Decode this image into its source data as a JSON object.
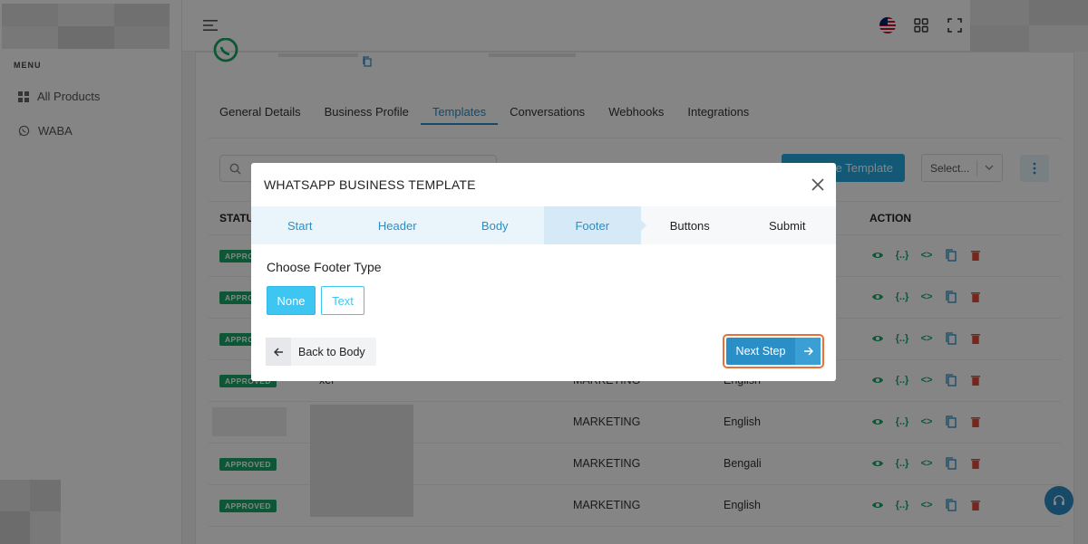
{
  "sidebar": {
    "menu_title": "MENU",
    "items": [
      {
        "label": "All Products",
        "icon": "grid-icon"
      },
      {
        "label": "WABA",
        "icon": "whatsapp-icon"
      }
    ]
  },
  "tabs": [
    "General Details",
    "Business Profile",
    "Templates",
    "Conversations",
    "Webhooks",
    "Integrations"
  ],
  "active_tab": "Templates",
  "toolbar": {
    "create_label": "e Template",
    "select_value": "Select..."
  },
  "table": {
    "headers": {
      "status": "STATU",
      "action": "ACTION"
    },
    "rows": [
      {
        "status": "APPROVED",
        "name": "",
        "category": "",
        "language": ""
      },
      {
        "status": "APPROVED",
        "name": "",
        "category": "",
        "language": ""
      },
      {
        "status": "APPROVED",
        "name": "",
        "category": "",
        "language": ""
      },
      {
        "status": "APPROVED",
        "name": "xel",
        "category": "MARKETING",
        "language": "English"
      },
      {
        "status": "",
        "name": "",
        "category": "MARKETING",
        "language": "English"
      },
      {
        "status": "APPROVED",
        "name": "",
        "category": "MARKETING",
        "language": "Bengali"
      },
      {
        "status": "APPROVED",
        "name": "",
        "category": "MARKETING",
        "language": "English"
      }
    ]
  },
  "modal": {
    "title": "WHATSAPP BUSINESS TEMPLATE",
    "steps": [
      "Start",
      "Header",
      "Body",
      "Footer",
      "Buttons",
      "Submit"
    ],
    "current_step": "Footer",
    "section_title": "Choose Footer Type",
    "options": [
      "None",
      "Text"
    ],
    "selected_option": "None",
    "back_label": "Back to Body",
    "next_label": "Next Step"
  },
  "colors": {
    "primary": "#2b8fc7",
    "accent": "#3ec6f3",
    "approved": "#1aa86a",
    "delete": "#e04b3a",
    "highlight": "#e8703a"
  }
}
